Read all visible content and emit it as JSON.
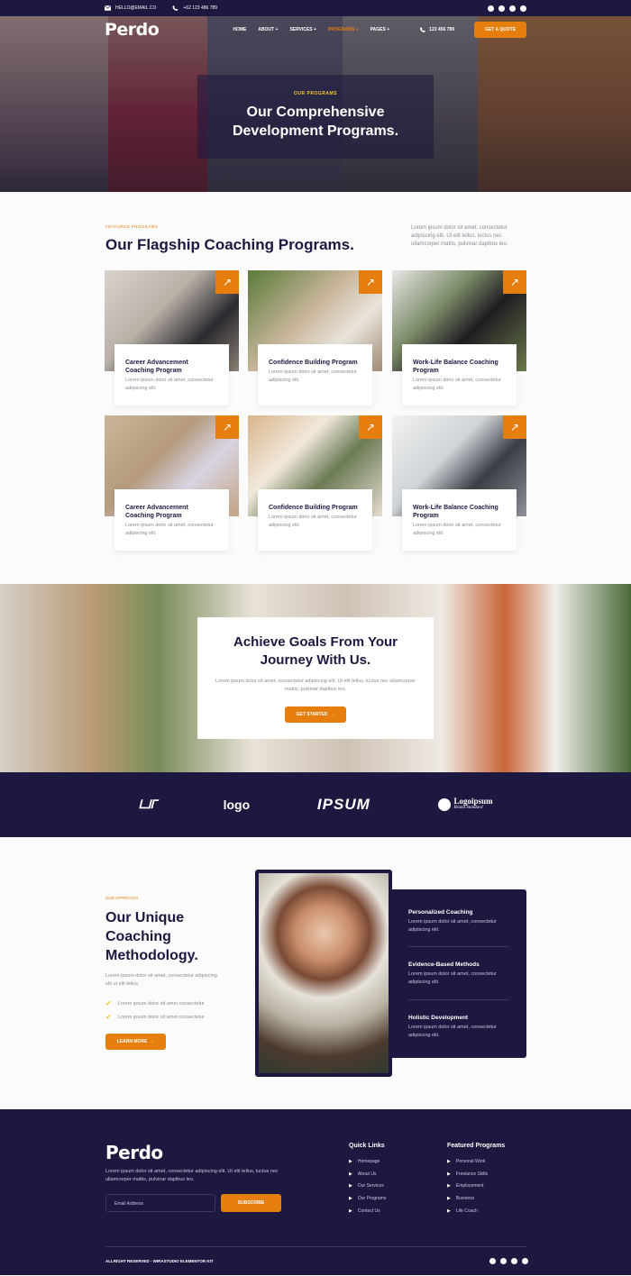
{
  "topbar": {
    "email": "HELLO@EMAIL.CO",
    "phone": "+62 123 486 789",
    "social": [
      "facebook-icon",
      "twitter-icon",
      "youtube-icon",
      "pinterest-icon"
    ]
  },
  "nav": {
    "logo_main": "Perdo",
    "items": [
      "HOME",
      "ABOUT +",
      "SERVICES +",
      "PROGRAMS +",
      "PAGES +"
    ],
    "phone": "123 456 789",
    "cta": "GET A QUOTE"
  },
  "hero": {
    "eyebrow": "OUR PROGRAMS",
    "title_line1": "Our Comprehensive",
    "title_line2": "Development Programs."
  },
  "programs": {
    "eyebrow": "FEATURED PROGRAMS",
    "title": "Our Flagship Coaching Programs.",
    "intro": "Lorem ipsum dolor sit amet, consectetur adipiscing elit. Ut elit tellus, luctus nec ullamcorper mattis, pulvinar dapibus leo.",
    "cards": [
      {
        "title": "Career Advancement Coaching Program",
        "text": "Lorem ipsum dolor sit amet, consectetur adipiscing elit."
      },
      {
        "title": "Confidence Building Program",
        "text": "Lorem ipsum dolor sit amet, consectetur adipiscing elit."
      },
      {
        "title": "Work-Life Balance Coaching Program",
        "text": "Lorem ipsum dolor sit amet, consectetur adipiscing elit."
      },
      {
        "title": "Career Advancement Coaching Program",
        "text": "Lorem ipsum dolor sit amet, consectetur adipiscing elit."
      },
      {
        "title": "Confidence Building Program",
        "text": "Lorem ipsum dolor sit amet, consectetur adipiscing elit."
      },
      {
        "title": "Work-Life Balance Coaching Program",
        "text": "Lorem ipsum dolor sit amet, consectetur adipiscing elit."
      }
    ]
  },
  "goals": {
    "title_line1": "Achieve Goals From Your",
    "title_line2": "Journey With Us.",
    "text": "Lorem ipsum dolor sit amet, consectetur adipiscing elit. Ut elit tellus, luctus nec ullamcorper mattis, pulvinar dapibus leo.",
    "button": "GET STARTED"
  },
  "logos": [
    "logo",
    "IPSUM",
    "Logoipsum",
    "Brand Standard"
  ],
  "approach": {
    "eyebrow": "OUR APPROACH",
    "title_line1": "Our Unique",
    "title_line2": "Coaching",
    "title_line3": "Methodology.",
    "text": "Lorem ipsum dolor sit amet, consectetur adipiscing elit ut elit tellus.",
    "checks": [
      "Lorem ipsum dolor sit amet consectetur",
      "Lorem ipsum dolor sit amet consectetur"
    ],
    "button": "LEARN MORE",
    "features": [
      {
        "title": "Personalized Coaching",
        "text": "Lorem ipsum dolor sit amet, consectetur adipiscing elit."
      },
      {
        "title": "Evidence-Based Methods",
        "text": "Lorem ipsum dolor sit amet, consectetur adipiscing elit."
      },
      {
        "title": "Holistic Development",
        "text": "Lorem ipsum dolor sit amet, consectetur adipiscing elit."
      }
    ]
  },
  "footer": {
    "logo": "Perdo",
    "desc": "Lorem ipsum dolor sit amet, consectetur adipiscing elit. Ut elit tellus, luctus nec ullamcorper mattis, pulvinar dapibus leo.",
    "email_placeholder": "Email Address",
    "subscribe": "SUBSCRIBE",
    "quick_links_title": "Quick Links",
    "quick_links": [
      "Homepage",
      "About Us",
      "Our Services",
      "Our Programs",
      "Contact Us"
    ],
    "featured_title": "Featured Programs",
    "featured": [
      "Personal Work",
      "Freelance Skills",
      "Employement",
      "Business",
      "Life Coach"
    ],
    "copyright": "ALLRIGHT RESERVED - WIRASTUDIO ELEMENTOR KIT"
  },
  "colors": {
    "navy": "#1c1840",
    "accent": "#e67e0e",
    "yellow": "#f4c430"
  }
}
